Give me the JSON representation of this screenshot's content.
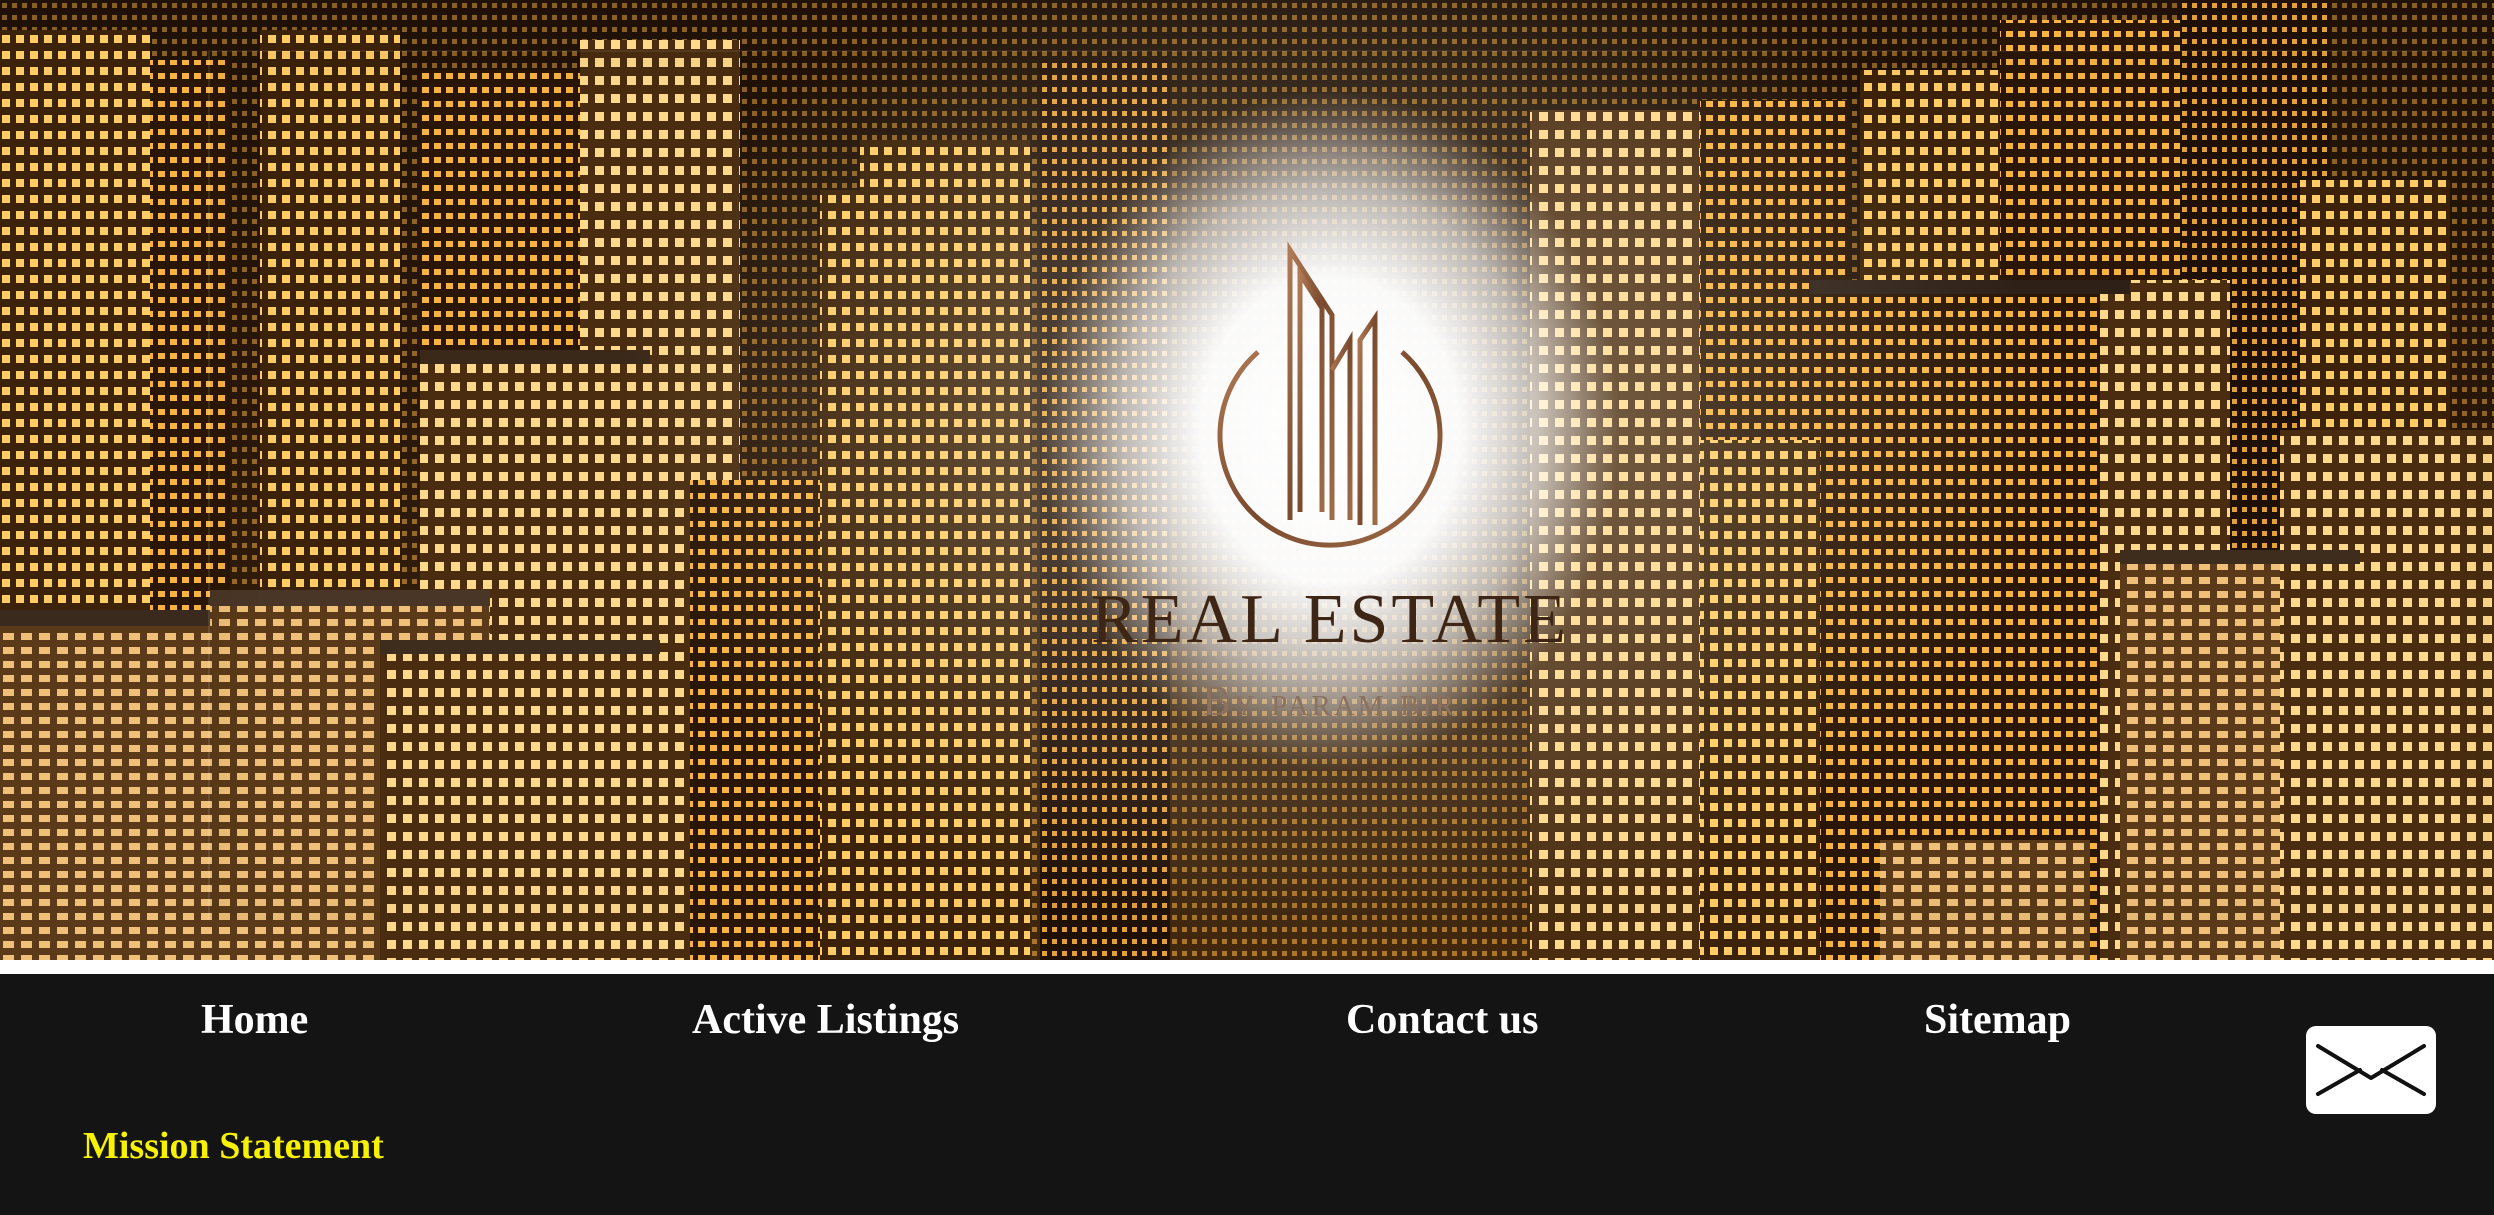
{
  "hero": {
    "logo_icon": "building-logo-icon",
    "brand_title": "REAL ESTATE",
    "brand_subtitle": "By param bir"
  },
  "nav": {
    "items": [
      {
        "label": "Home"
      },
      {
        "label": "Active Listings"
      },
      {
        "label": "Contact us"
      },
      {
        "label": "Sitemap"
      }
    ],
    "mail_icon": "envelope-icon"
  },
  "content": {
    "mission_heading": "Mission Statement"
  },
  "colors": {
    "nav_background": "#151415",
    "nav_text": "#ffffff",
    "mission_heading": "#f6f200",
    "logo_brown": "#8b5a3c",
    "brand_text": "#3e2617"
  }
}
